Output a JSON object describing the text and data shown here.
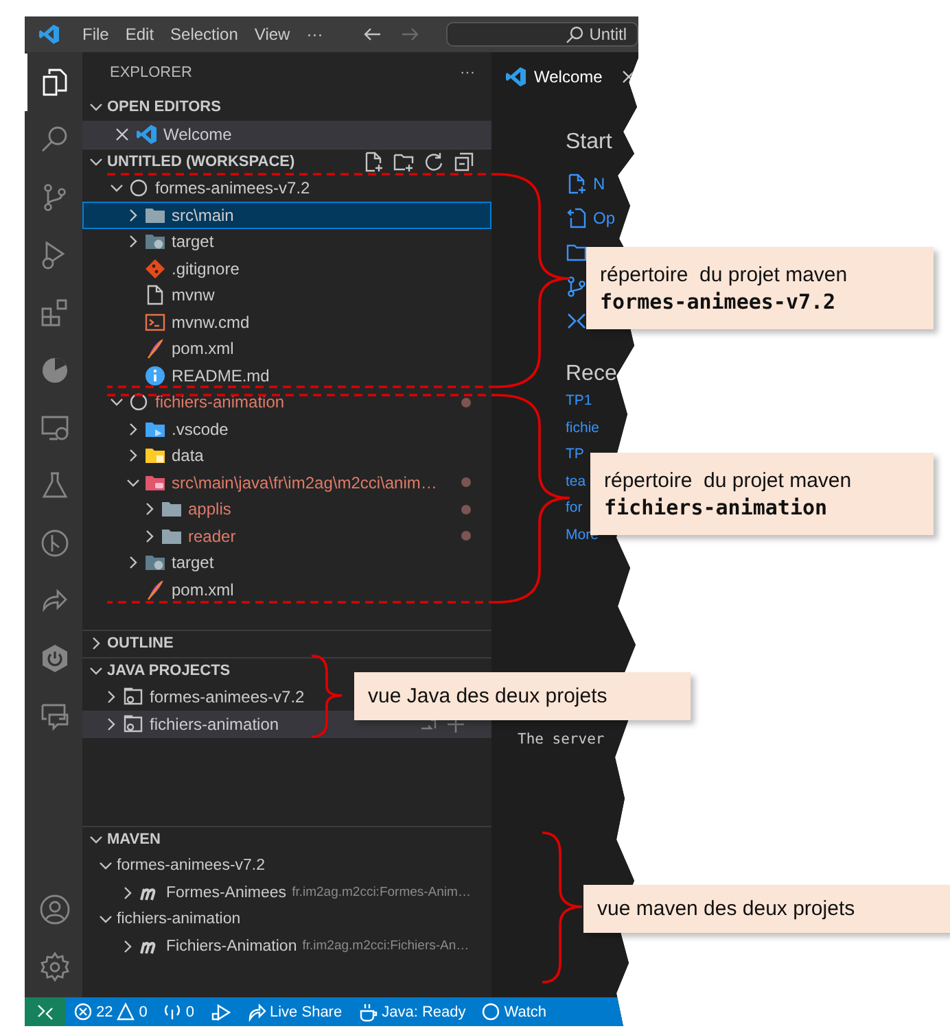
{
  "title_bar": {
    "menu": [
      "File",
      "Edit",
      "Selection",
      "View",
      "···"
    ],
    "search": {
      "value": "Untitl"
    }
  },
  "activity_bar": {
    "top": [
      {
        "kind": "files",
        "selected": true
      },
      {
        "kind": "search",
        "selected": false
      },
      {
        "kind": "source_control",
        "selected": false
      },
      {
        "kind": "run_debug",
        "selected": false
      },
      {
        "kind": "extensions",
        "selected": false
      },
      {
        "kind": "pie",
        "selected": false
      },
      {
        "kind": "remote",
        "selected": false
      },
      {
        "kind": "testing",
        "selected": false
      },
      {
        "kind": "git_graph",
        "selected": false
      },
      {
        "kind": "live_share",
        "selected": false
      },
      {
        "kind": "power",
        "selected": false
      },
      {
        "kind": "feedback",
        "selected": false
      }
    ],
    "bottom": [
      {
        "kind": "account",
        "selected": false
      },
      {
        "kind": "settings",
        "selected": false
      }
    ]
  },
  "sidebar": {
    "title": "EXPLORER",
    "more": "···",
    "sections": [
      {
        "kind": "open_editors",
        "title": "OPEN EDITORS",
        "expanded": true,
        "items": [
          {
            "label": "Welcome",
            "selected": true
          }
        ]
      },
      {
        "kind": "workspace",
        "title": "UNTITLED (WORKSPACE)",
        "expanded": true,
        "tree": [
          {
            "label": "formes-animees-v7.2",
            "kind": "root",
            "expanded": true,
            "selected": false,
            "has_problems": false,
            "children": [
              {
                "label": "src\\main",
                "kind": "folder",
                "expanded": false,
                "selected": true,
                "has_problems": false
              },
              {
                "label": "target",
                "kind": "folder_target",
                "expanded": false,
                "selected": false,
                "has_problems": false
              },
              {
                "label": ".gitignore",
                "kind": "git",
                "selected": false,
                "has_problems": false
              },
              {
                "label": "mvnw",
                "kind": "file",
                "selected": false,
                "has_problems": false
              },
              {
                "label": "mvnw.cmd",
                "kind": "terminal",
                "selected": false,
                "has_problems": false
              },
              {
                "label": "pom.xml",
                "kind": "feather",
                "selected": false,
                "has_problems": false
              },
              {
                "label": "README.md",
                "kind": "info",
                "selected": false,
                "has_problems": false
              }
            ]
          },
          {
            "label": "fichiers-animation",
            "kind": "root",
            "expanded": true,
            "selected": false,
            "has_problems": true,
            "children": [
              {
                "label": ".vscode",
                "kind": "folder_vscode",
                "expanded": false,
                "selected": false,
                "has_problems": false
              },
              {
                "label": "data",
                "kind": "folder_data",
                "expanded": false,
                "selected": false,
                "has_problems": false
              },
              {
                "label": "src\\main\\java\\fr\\im2ag\\m2cci\\anim…",
                "kind": "folder_src",
                "expanded": true,
                "selected": false,
                "has_problems": true,
                "children": [
                  {
                    "label": "applis",
                    "kind": "folder",
                    "expanded": false,
                    "selected": false,
                    "has_problems": true
                  },
                  {
                    "label": "reader",
                    "kind": "folder",
                    "expanded": false,
                    "selected": false,
                    "has_problems": true
                  }
                ]
              },
              {
                "label": "target",
                "kind": "folder_target",
                "expanded": false,
                "selected": false,
                "has_problems": false
              },
              {
                "label": "pom.xml",
                "kind": "feather",
                "selected": false,
                "has_problems": false
              }
            ]
          }
        ]
      },
      {
        "kind": "outline",
        "title": "OUTLINE",
        "expanded": false
      },
      {
        "kind": "java_projects",
        "title": "JAVA PROJECTS",
        "expanded": true,
        "items": [
          {
            "label": "formes-animees-v7.2",
            "expanded": false,
            "hovered": false
          },
          {
            "label": "fichiers-animation",
            "expanded": false,
            "hovered": true
          }
        ]
      },
      {
        "kind": "maven",
        "title": "MAVEN",
        "expanded": true,
        "tree": [
          {
            "label": "formes-animees-v7.2",
            "expanded": true,
            "children": [
              {
                "label": "Formes-Animees",
                "description": "fr.im2ag.m2cci:Formes-Anim…",
                "kind": "maven",
                "expanded": false
              }
            ]
          },
          {
            "label": "fichiers-animation",
            "expanded": true,
            "children": [
              {
                "label": "Fichiers-Animation",
                "description": "fr.im2ag.m2cci:Fichiers-An…",
                "kind": "maven",
                "expanded": false
              }
            ]
          }
        ]
      }
    ]
  },
  "editor": {
    "tabs": [
      {
        "label": "Welcome",
        "selected": true
      }
    ],
    "start": {
      "heading": "Start",
      "items": [
        {
          "kind": "new_file",
          "label": "N"
        },
        {
          "kind": "open_file",
          "label": "Op"
        },
        {
          "kind": "folder"
        },
        {
          "kind": "git"
        },
        {
          "kind": "remote"
        }
      ]
    },
    "recent": {
      "heading": "Rece",
      "items": [
        "TP1",
        "fichie",
        "TP",
        "tea",
        "for"
      ],
      "more": "More"
    },
    "terminal": "The server"
  },
  "status_bar": [
    {
      "kind": "remote"
    },
    {
      "kind": "problems",
      "errors": "22",
      "warnings": "0"
    },
    {
      "kind": "ports",
      "text": "0"
    },
    {
      "kind": "debug"
    },
    {
      "kind": "live_share",
      "text": "Live Share"
    },
    {
      "kind": "java",
      "text": "Java: Ready"
    },
    {
      "kind": "watch",
      "text": "Watch"
    }
  ],
  "annotations": [
    {
      "text": "répertoire  du projet maven",
      "code": "formes-animees-v7.2"
    },
    {
      "text": "répertoire  du projet maven",
      "code": "fichiers-animation"
    },
    {
      "text": "vue Java des deux projets"
    },
    {
      "text": "vue maven des deux projets"
    }
  ]
}
